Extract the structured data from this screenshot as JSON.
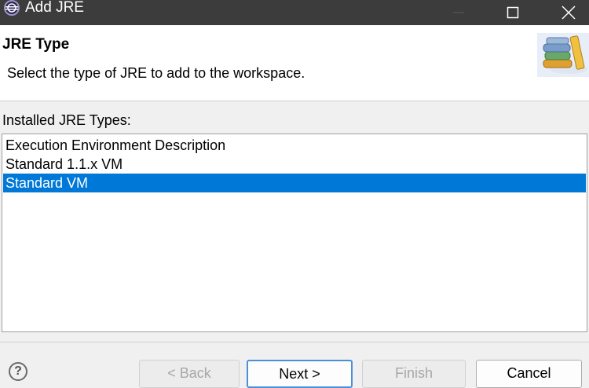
{
  "window": {
    "title": "Add JRE",
    "controls": [
      "minimize-icon",
      "maximize-icon",
      "close-icon"
    ]
  },
  "banner": {
    "title": "JRE Type",
    "message": "Select the type of JRE to add to the workspace.",
    "image": "books-icon"
  },
  "content": {
    "list_label": "Installed JRE Types:",
    "items": [
      {
        "label": "Execution Environment Description",
        "selected": false
      },
      {
        "label": "Standard 1.1.x VM",
        "selected": false
      },
      {
        "label": "Standard VM",
        "selected": true
      }
    ]
  },
  "buttons": {
    "help": "?",
    "back": "< Back",
    "next": "Next >",
    "finish": "Finish",
    "cancel": "Cancel"
  },
  "colors": {
    "selection": "#0078d7",
    "titlebar": "#3c3c3c"
  }
}
